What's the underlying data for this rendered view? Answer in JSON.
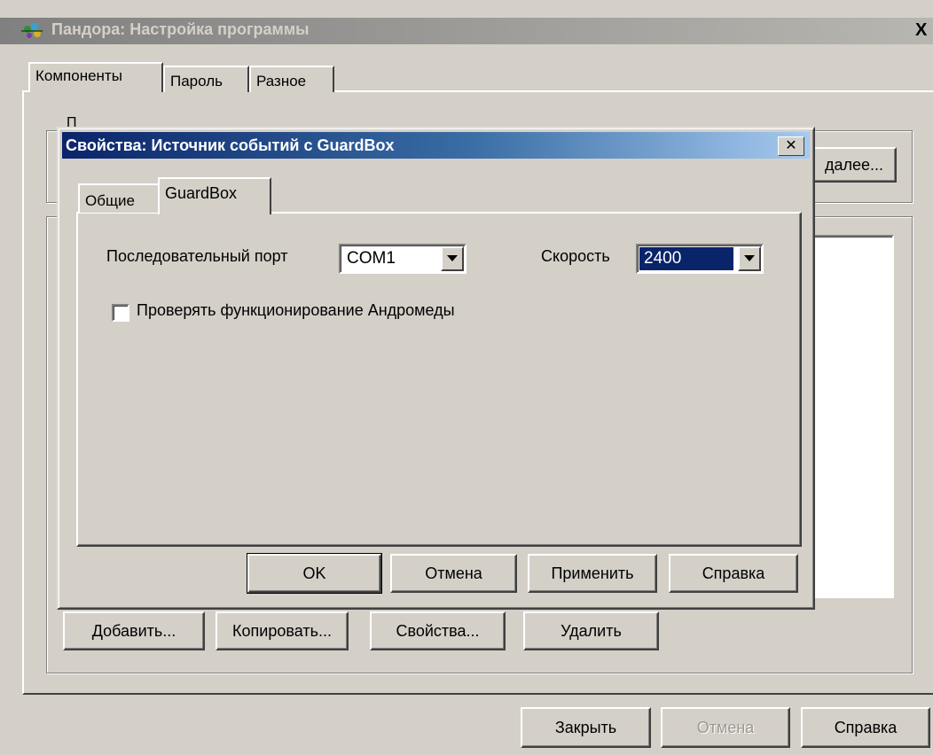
{
  "main_window": {
    "title": "Пандора: Настройка программы",
    "close_glyph": "X",
    "tabs": [
      {
        "label": "Компоненты",
        "active": true
      },
      {
        "label": "Пароль",
        "active": false
      },
      {
        "label": "Разное",
        "active": false
      }
    ],
    "group_caption_partial": "П",
    "more_button": "далее...",
    "component_buttons": {
      "add": "Добавить...",
      "copy": "Копировать...",
      "properties": "Свойства...",
      "delete": "Удалить"
    },
    "footer_buttons": {
      "close": "Закрыть",
      "cancel": "Отмена",
      "help": "Справка"
    }
  },
  "dialog": {
    "title": "Свойства: Источник событий с GuardBox",
    "close_glyph": "✕",
    "tabs": [
      {
        "label": "Общие",
        "active": false
      },
      {
        "label": "GuardBox",
        "active": true
      }
    ],
    "serial_port": {
      "label": "Последовательный порт",
      "value": "COM1"
    },
    "speed": {
      "label": "Скорость",
      "value": "2400"
    },
    "check_andromeda": {
      "label": "Проверять функционирование Андромеды",
      "checked": false
    },
    "buttons": {
      "ok": "OK",
      "cancel": "Отмена",
      "apply": "Применить",
      "help": "Справка"
    }
  },
  "colors": {
    "face": "#d4d0c8",
    "active_title_start": "#0a246a",
    "active_title_end": "#a6caf0",
    "inactive_title": "#808080",
    "selection": "#0a246a"
  }
}
